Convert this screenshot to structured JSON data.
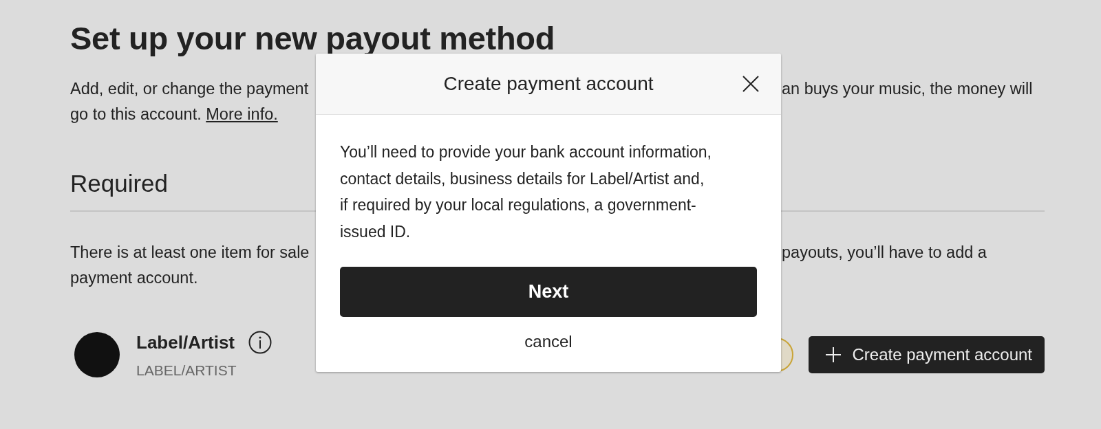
{
  "page": {
    "title": "Set up your new payout method",
    "intro": {
      "line_1_left": "Add, edit, or change the payment",
      "line_1_right": "an buys your music, the money will",
      "line_2": "go to this account.",
      "link": "More info."
    },
    "section": {
      "heading": "Required",
      "line_1_left": "There is at least one item for sale",
      "line_1_right": "payouts, you’ll have to add a",
      "line_2": "payment account."
    },
    "account": {
      "name": "Label/Artist",
      "type": "LABEL/ARTIST"
    },
    "create_button": {
      "label": "Create payment account"
    }
  },
  "dialog": {
    "title": "Create payment account",
    "body": "You’ll need to provide your bank account information, contact details, business details for Label/Artist and, if required by your local regulations, a government-issued ID.",
    "primary_button": "Next",
    "cancel": "cancel"
  }
}
